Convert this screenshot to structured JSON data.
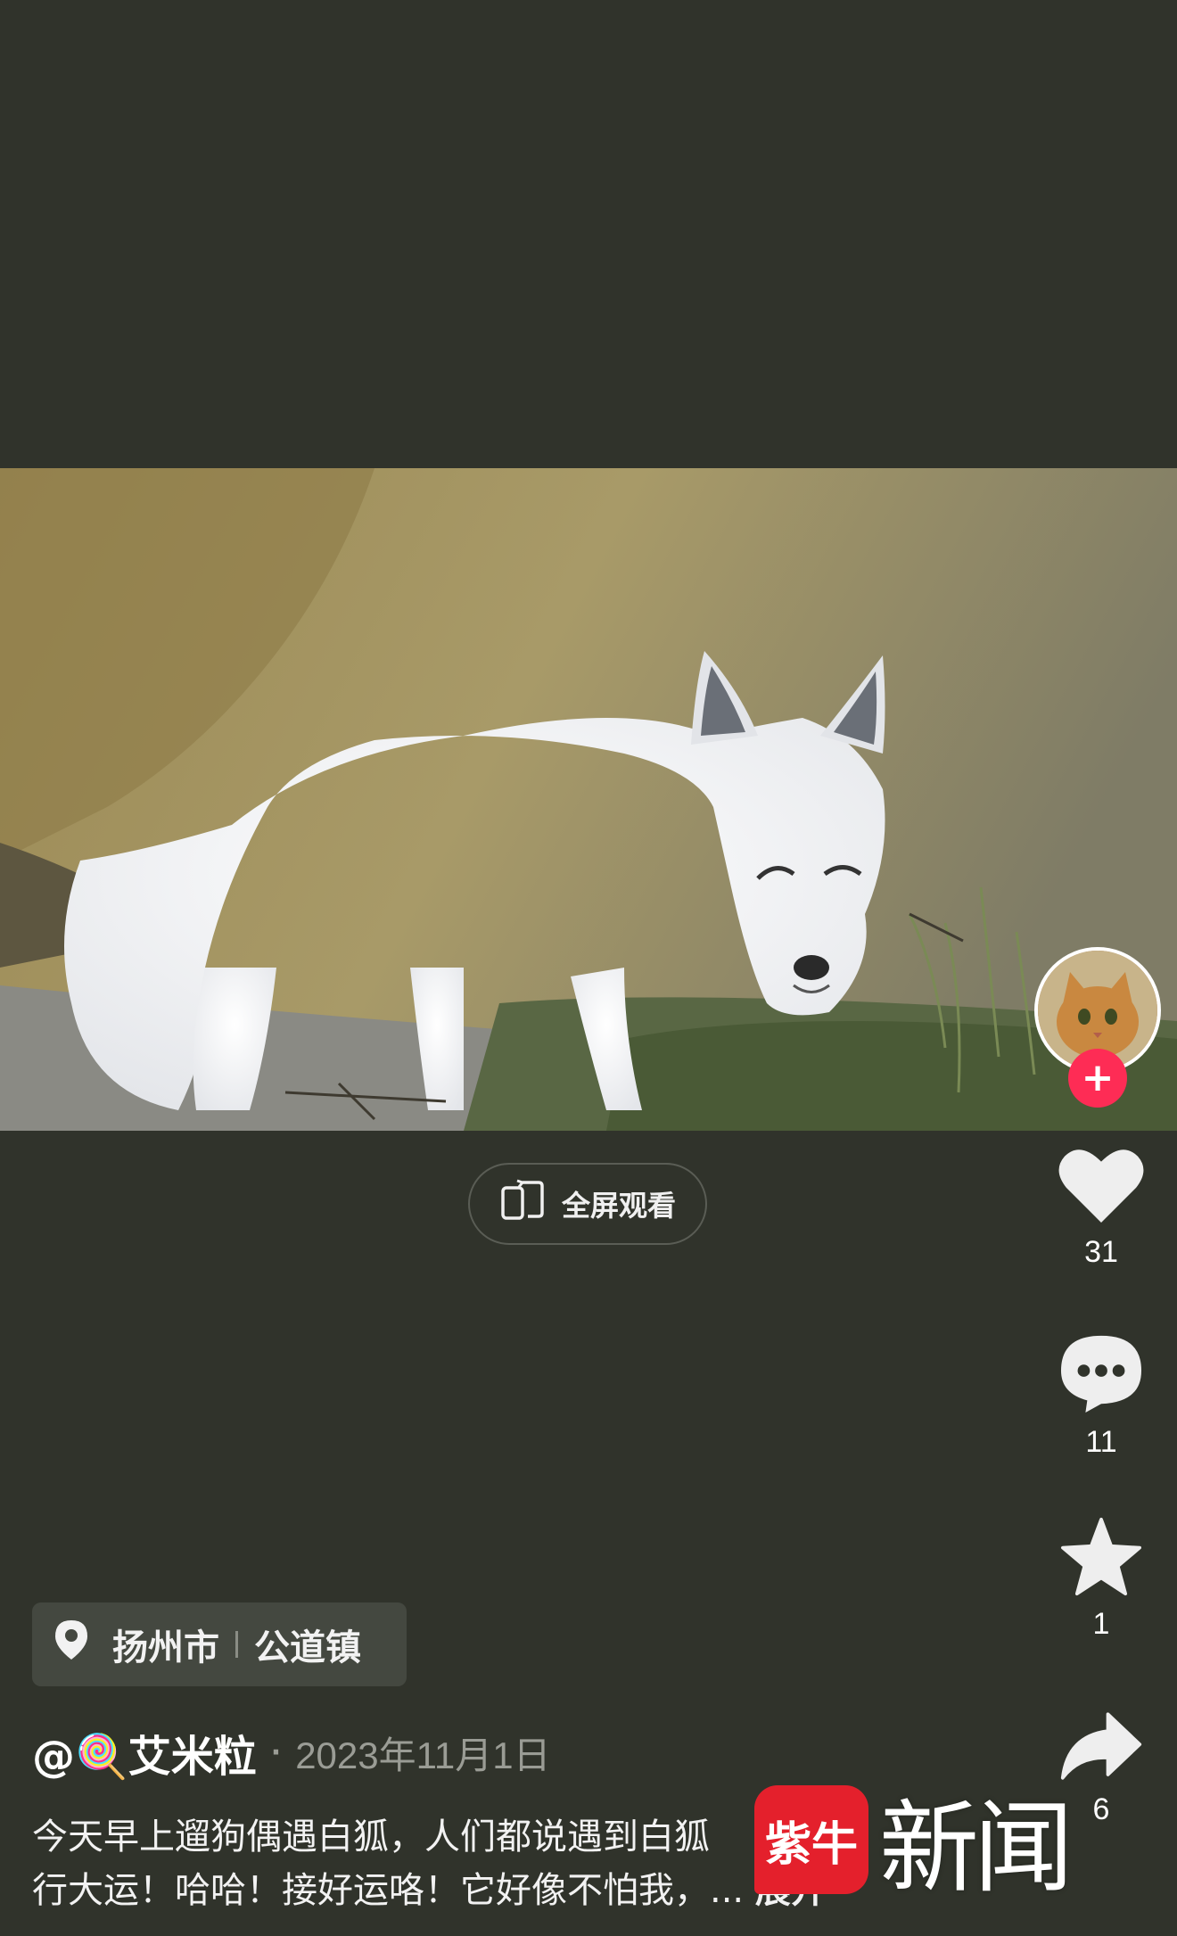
{
  "video": {
    "fullscreen_label": "全屏观看"
  },
  "actions": {
    "likes": "31",
    "comments": "11",
    "favorites": "1",
    "shares": "6"
  },
  "location": {
    "city": "扬州市",
    "town": "公道镇"
  },
  "post": {
    "author_prefix": "@",
    "author_emoji": "🍭",
    "author_name": "艾米粒",
    "date": "2023年11月1日",
    "description_line1": "今天早上遛狗偶遇白狐，人们都说遇到白狐",
    "description_line2": "行大运！哈哈！接好运咯！它好像不怕我，...",
    "expand_label": "展开"
  },
  "watermark": {
    "logo_text": "紫牛",
    "text": "新闻"
  },
  "icons": [
    "fullscreen-rotate-icon",
    "heart-icon",
    "comment-icon",
    "star-icon",
    "share-icon",
    "location-pin-icon",
    "plus-icon"
  ],
  "colors": {
    "background": "#30332b",
    "follow_accent": "#fe2c55",
    "watermark_red": "#e4202c"
  }
}
